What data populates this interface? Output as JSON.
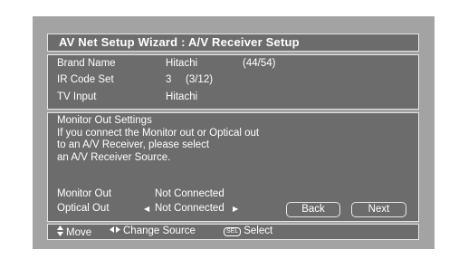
{
  "wizard": {
    "title": "AV Net Setup Wizard : A/V Receiver Setup"
  },
  "info": {
    "brand_label": "Brand Name",
    "brand_value": "Hitachi",
    "brand_count": "(44/54)",
    "ir_label": "IR Code Set",
    "ir_value": "3",
    "ir_count": "(3/12)",
    "tv_label": "TV Input",
    "tv_value": "Hitachi"
  },
  "settings": {
    "heading": "Monitor Out Settings",
    "line1": "If you connect the Monitor out or Optical out",
    "line2": "to an A/V Receiver, please select",
    "line3": "an A/V Receiver Source.",
    "monitor_label": "Monitor Out",
    "monitor_value": "Not Connected",
    "optical_label": "Optical Out",
    "optical_value": "Not Connected"
  },
  "buttons": {
    "back": "Back",
    "next": "Next"
  },
  "footer": {
    "move": "Move",
    "change_source": "Change Source",
    "sel_badge": "SEL",
    "select": "Select"
  }
}
